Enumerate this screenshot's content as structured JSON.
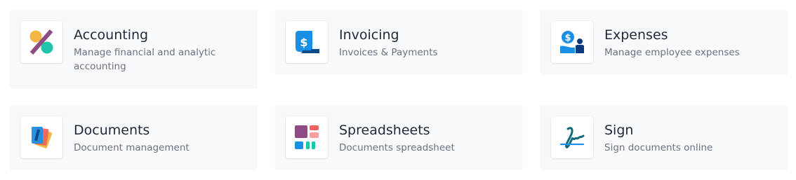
{
  "apps": [
    {
      "title": "Accounting",
      "description": "Manage financial and analytic accounting",
      "icon": "accounting-icon"
    },
    {
      "title": "Invoicing",
      "description": "Invoices & Payments",
      "icon": "invoice-dollar-icon"
    },
    {
      "title": "Expenses",
      "description": "Manage employee expenses",
      "icon": "expenses-person-dollar-icon"
    },
    {
      "title": "Documents",
      "description": "Document management",
      "icon": "documents-stack-icon"
    },
    {
      "title": "Spreadsheets",
      "description": "Documents spreadsheet",
      "icon": "spreadsheet-grid-icon"
    },
    {
      "title": "Sign",
      "description": "Sign documents online",
      "icon": "signature-icon"
    }
  ],
  "colors": {
    "card_bg": "#f8f9fb",
    "title": "#1f2937",
    "description": "#6b7280",
    "accent_purple": "#8e4b84",
    "accent_teal": "#1fc5a8",
    "accent_orange": "#f5b543",
    "accent_blue": "#1a8fe6",
    "accent_red": "#f06060"
  }
}
